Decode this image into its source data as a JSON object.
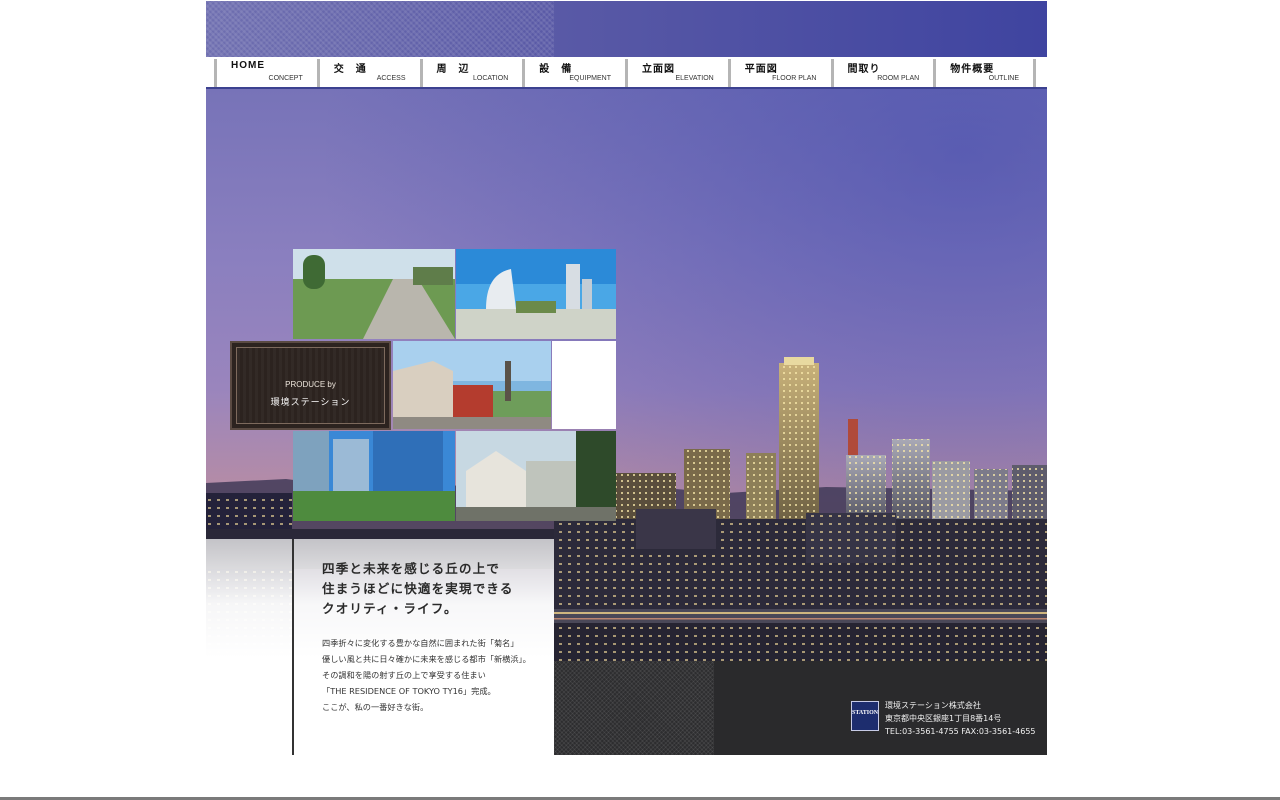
{
  "nav": {
    "items": [
      {
        "ja": "HOME",
        "en": "CONCEPT"
      },
      {
        "ja": "交　通",
        "en": "ACCESS"
      },
      {
        "ja": "周　辺",
        "en": "LOCATION"
      },
      {
        "ja": "設　備",
        "en": "EQUIPMENT"
      },
      {
        "ja": "立面図",
        "en": "ELEVATION"
      },
      {
        "ja": "平面図",
        "en": "FLOOR PLAN"
      },
      {
        "ja": "間取り",
        "en": "ROOM PLAN"
      },
      {
        "ja": "物件概要",
        "en": "OUTLINE"
      }
    ]
  },
  "produce": {
    "en": "PRODUCE by",
    "ja": "環境ステーション"
  },
  "headline": {
    "lines": [
      "四季と未来を感じる丘の上で",
      "住まうほどに快適を実現できる",
      "クオリティ・ライフ。"
    ]
  },
  "body": {
    "lines": [
      "四季折々に変化する豊かな自然に囲まれた街「菊名」",
      "優しい風と共に日々確かに未来を感じる都市「新横浜」。",
      "その調和を陽の射す丘の上で享受する住まい",
      "「THE RESIDENCE OF TOKYO TY16」完成。",
      "ここが、私の一番好きな街。"
    ]
  },
  "company": {
    "logo_text": "STATION",
    "name": "環境ステーション株式会社",
    "address": "東京都中央区銀座1丁目8番14号",
    "tel": "TEL:03-3561-4755 FAX:03-3561-4655"
  },
  "colors": {
    "header_blue": "#3f44a0",
    "nav_rule": "#3c4190",
    "produce_bg": "#2c231f",
    "footer_dark": "#2a2a2c"
  }
}
